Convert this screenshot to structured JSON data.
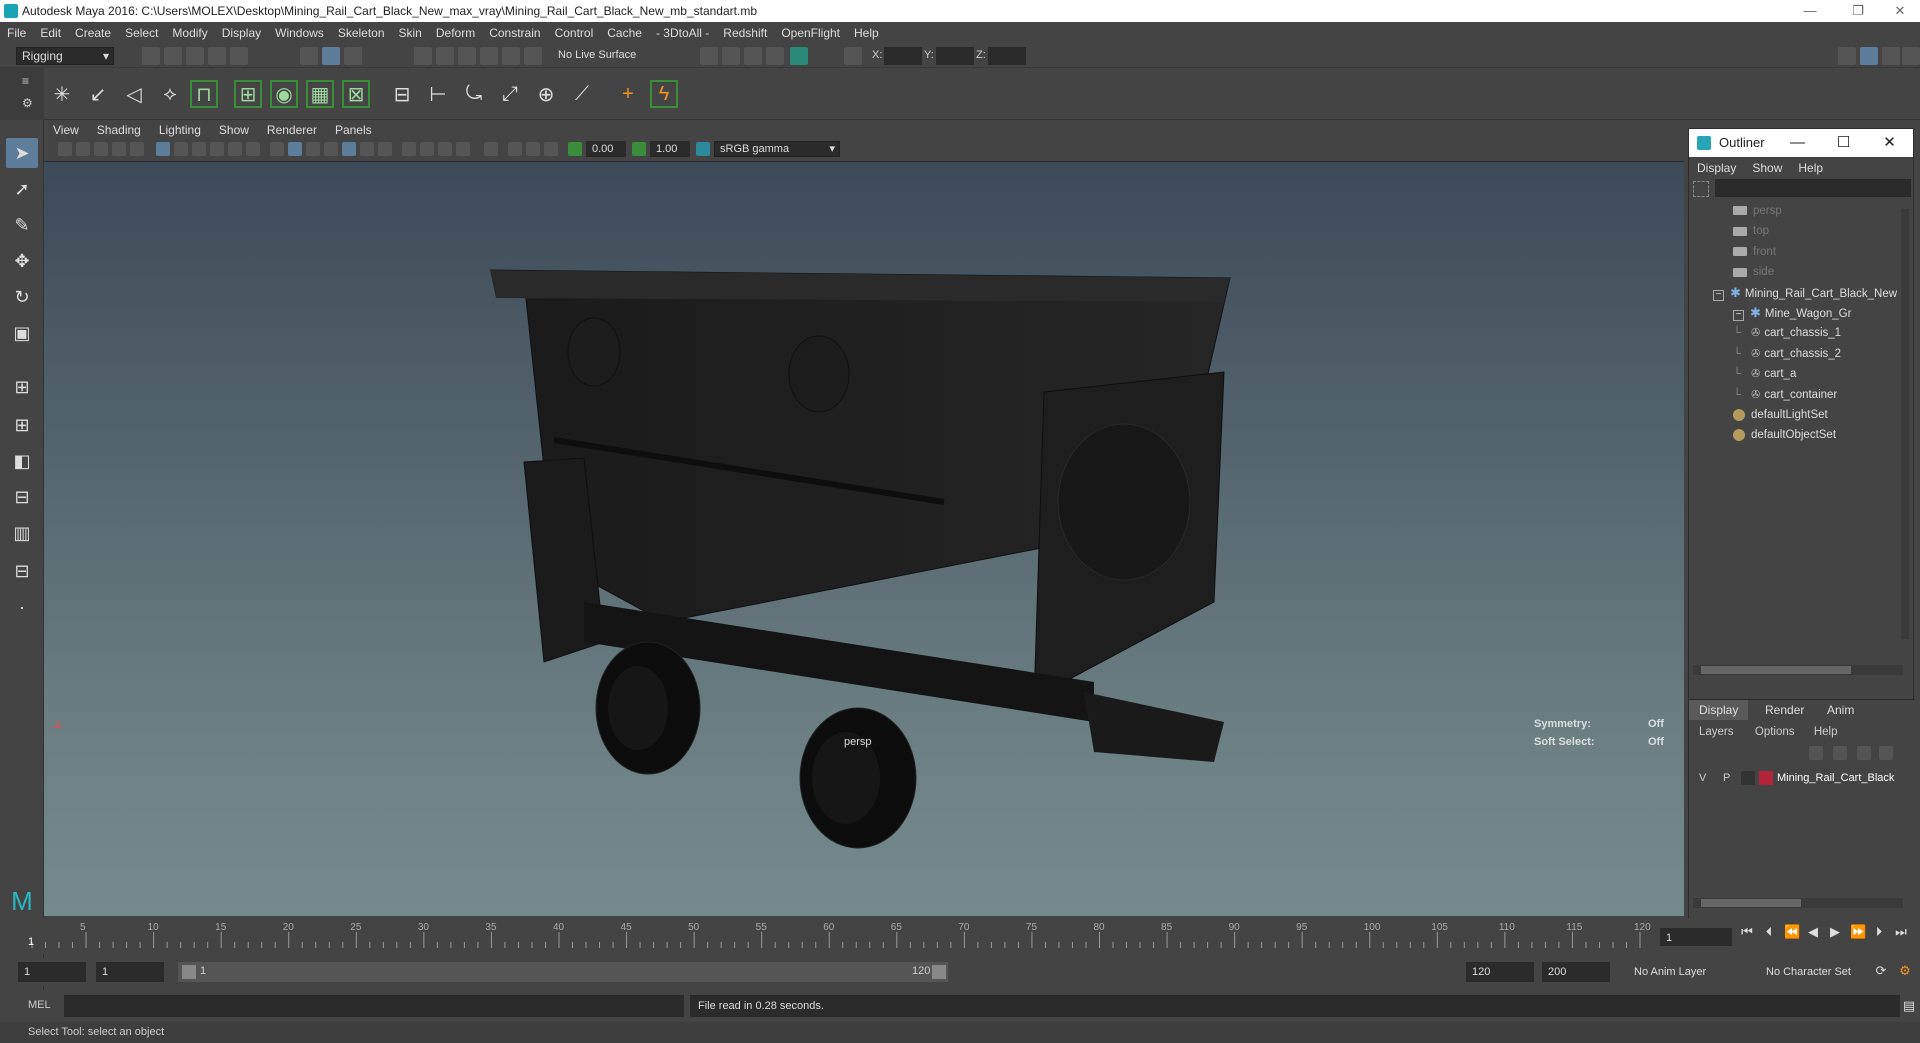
{
  "titlebar": {
    "title": "Autodesk Maya 2016: C:\\Users\\MOLEX\\Desktop\\Mining_Rail_Cart_Black_New_max_vray\\Mining_Rail_Cart_Black_New_mb_standart.mb"
  },
  "menubar": {
    "items": [
      "File",
      "Edit",
      "Create",
      "Select",
      "Modify",
      "Display",
      "Windows",
      "Skeleton",
      "Skin",
      "Deform",
      "Constrain",
      "Control",
      "Cache",
      "- 3DtoAll -",
      "Redshift",
      "OpenFlight",
      "Help"
    ]
  },
  "statusline": {
    "mode": "Rigging",
    "live_surface": "No Live Surface",
    "x_label": "X:",
    "y_label": "Y:",
    "z_label": "Z:"
  },
  "viewport": {
    "menu": [
      "View",
      "Shading",
      "Lighting",
      "Show",
      "Renderer",
      "Panels"
    ],
    "exposure": "0.00",
    "gamma": "1.00",
    "color_space": "sRGB gamma",
    "camera_label": "persp",
    "symmetry_label": "Symmetry:",
    "symmetry_value": "Off",
    "soft_select_label": "Soft Select:",
    "soft_select_value": "Off"
  },
  "outliner": {
    "title": "Outliner",
    "menu": [
      "Display",
      "Show",
      "Help"
    ],
    "cameras": [
      "persp",
      "top",
      "front",
      "side"
    ],
    "root": "Mining_Rail_Cart_Black_New",
    "group": "Mine_Wagon_Gr",
    "meshes": [
      "cart_chassis_1",
      "cart_chassis_2",
      "cart_a",
      "cart_container"
    ],
    "sets": [
      "defaultLightSet",
      "defaultObjectSet"
    ]
  },
  "layers": {
    "tabs": [
      "Display",
      "Render",
      "Anim"
    ],
    "menu": [
      "Layers",
      "Options",
      "Help"
    ],
    "v": "V",
    "p": "P",
    "layer_name": "Mining_Rail_Cart_Black",
    "layer_color": "#b3233a"
  },
  "timeline": {
    "ticks": [
      "5",
      "10",
      "15",
      "20",
      "25",
      "30",
      "35",
      "40",
      "45",
      "50",
      "55",
      "60",
      "65",
      "70",
      "75",
      "80",
      "85",
      "90",
      "95",
      "100",
      "105",
      "110",
      "115",
      "120"
    ],
    "start_marker": "1",
    "current_frame": "1"
  },
  "range": {
    "start": "1",
    "start_inner": "1",
    "slider_start": "1",
    "slider_end": "120",
    "end_inner": "120",
    "end": "200",
    "anim_layer": "No Anim Layer",
    "character_set": "No Character Set"
  },
  "cmdline": {
    "label": "MEL",
    "result": "File read in  0.28 seconds."
  },
  "helpline": {
    "text": "Select Tool: select an object"
  }
}
